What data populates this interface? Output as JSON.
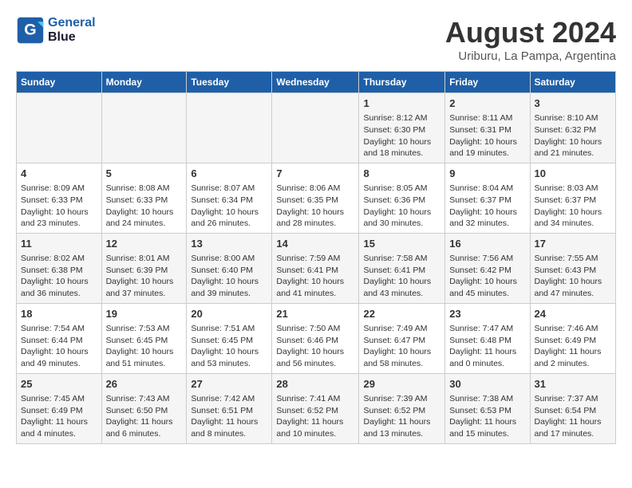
{
  "header": {
    "logo_line1": "General",
    "logo_line2": "Blue",
    "month_year": "August 2024",
    "location": "Uriburu, La Pampa, Argentina"
  },
  "weekdays": [
    "Sunday",
    "Monday",
    "Tuesday",
    "Wednesday",
    "Thursday",
    "Friday",
    "Saturday"
  ],
  "weeks": [
    [
      {
        "day": "",
        "info": ""
      },
      {
        "day": "",
        "info": ""
      },
      {
        "day": "",
        "info": ""
      },
      {
        "day": "",
        "info": ""
      },
      {
        "day": "1",
        "info": "Sunrise: 8:12 AM\nSunset: 6:30 PM\nDaylight: 10 hours\nand 18 minutes."
      },
      {
        "day": "2",
        "info": "Sunrise: 8:11 AM\nSunset: 6:31 PM\nDaylight: 10 hours\nand 19 minutes."
      },
      {
        "day": "3",
        "info": "Sunrise: 8:10 AM\nSunset: 6:32 PM\nDaylight: 10 hours\nand 21 minutes."
      }
    ],
    [
      {
        "day": "4",
        "info": "Sunrise: 8:09 AM\nSunset: 6:33 PM\nDaylight: 10 hours\nand 23 minutes."
      },
      {
        "day": "5",
        "info": "Sunrise: 8:08 AM\nSunset: 6:33 PM\nDaylight: 10 hours\nand 24 minutes."
      },
      {
        "day": "6",
        "info": "Sunrise: 8:07 AM\nSunset: 6:34 PM\nDaylight: 10 hours\nand 26 minutes."
      },
      {
        "day": "7",
        "info": "Sunrise: 8:06 AM\nSunset: 6:35 PM\nDaylight: 10 hours\nand 28 minutes."
      },
      {
        "day": "8",
        "info": "Sunrise: 8:05 AM\nSunset: 6:36 PM\nDaylight: 10 hours\nand 30 minutes."
      },
      {
        "day": "9",
        "info": "Sunrise: 8:04 AM\nSunset: 6:37 PM\nDaylight: 10 hours\nand 32 minutes."
      },
      {
        "day": "10",
        "info": "Sunrise: 8:03 AM\nSunset: 6:37 PM\nDaylight: 10 hours\nand 34 minutes."
      }
    ],
    [
      {
        "day": "11",
        "info": "Sunrise: 8:02 AM\nSunset: 6:38 PM\nDaylight: 10 hours\nand 36 minutes."
      },
      {
        "day": "12",
        "info": "Sunrise: 8:01 AM\nSunset: 6:39 PM\nDaylight: 10 hours\nand 37 minutes."
      },
      {
        "day": "13",
        "info": "Sunrise: 8:00 AM\nSunset: 6:40 PM\nDaylight: 10 hours\nand 39 minutes."
      },
      {
        "day": "14",
        "info": "Sunrise: 7:59 AM\nSunset: 6:41 PM\nDaylight: 10 hours\nand 41 minutes."
      },
      {
        "day": "15",
        "info": "Sunrise: 7:58 AM\nSunset: 6:41 PM\nDaylight: 10 hours\nand 43 minutes."
      },
      {
        "day": "16",
        "info": "Sunrise: 7:56 AM\nSunset: 6:42 PM\nDaylight: 10 hours\nand 45 minutes."
      },
      {
        "day": "17",
        "info": "Sunrise: 7:55 AM\nSunset: 6:43 PM\nDaylight: 10 hours\nand 47 minutes."
      }
    ],
    [
      {
        "day": "18",
        "info": "Sunrise: 7:54 AM\nSunset: 6:44 PM\nDaylight: 10 hours\nand 49 minutes."
      },
      {
        "day": "19",
        "info": "Sunrise: 7:53 AM\nSunset: 6:45 PM\nDaylight: 10 hours\nand 51 minutes."
      },
      {
        "day": "20",
        "info": "Sunrise: 7:51 AM\nSunset: 6:45 PM\nDaylight: 10 hours\nand 53 minutes."
      },
      {
        "day": "21",
        "info": "Sunrise: 7:50 AM\nSunset: 6:46 PM\nDaylight: 10 hours\nand 56 minutes."
      },
      {
        "day": "22",
        "info": "Sunrise: 7:49 AM\nSunset: 6:47 PM\nDaylight: 10 hours\nand 58 minutes."
      },
      {
        "day": "23",
        "info": "Sunrise: 7:47 AM\nSunset: 6:48 PM\nDaylight: 11 hours\nand 0 minutes."
      },
      {
        "day": "24",
        "info": "Sunrise: 7:46 AM\nSunset: 6:49 PM\nDaylight: 11 hours\nand 2 minutes."
      }
    ],
    [
      {
        "day": "25",
        "info": "Sunrise: 7:45 AM\nSunset: 6:49 PM\nDaylight: 11 hours\nand 4 minutes."
      },
      {
        "day": "26",
        "info": "Sunrise: 7:43 AM\nSunset: 6:50 PM\nDaylight: 11 hours\nand 6 minutes."
      },
      {
        "day": "27",
        "info": "Sunrise: 7:42 AM\nSunset: 6:51 PM\nDaylight: 11 hours\nand 8 minutes."
      },
      {
        "day": "28",
        "info": "Sunrise: 7:41 AM\nSunset: 6:52 PM\nDaylight: 11 hours\nand 10 minutes."
      },
      {
        "day": "29",
        "info": "Sunrise: 7:39 AM\nSunset: 6:52 PM\nDaylight: 11 hours\nand 13 minutes."
      },
      {
        "day": "30",
        "info": "Sunrise: 7:38 AM\nSunset: 6:53 PM\nDaylight: 11 hours\nand 15 minutes."
      },
      {
        "day": "31",
        "info": "Sunrise: 7:37 AM\nSunset: 6:54 PM\nDaylight: 11 hours\nand 17 minutes."
      }
    ]
  ]
}
